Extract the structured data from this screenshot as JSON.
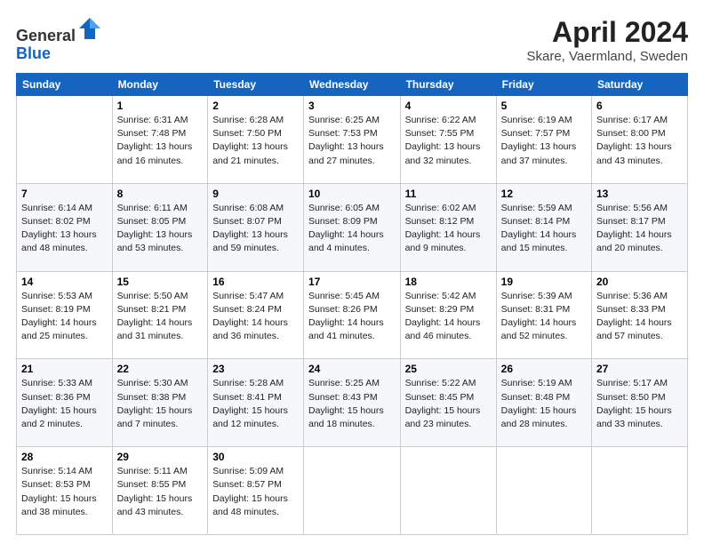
{
  "header": {
    "logo_line1": "General",
    "logo_line2": "Blue",
    "title": "April 2024",
    "subtitle": "Skare, Vaermland, Sweden"
  },
  "days_of_week": [
    "Sunday",
    "Monday",
    "Tuesday",
    "Wednesday",
    "Thursday",
    "Friday",
    "Saturday"
  ],
  "weeks": [
    [
      {
        "day": "",
        "info": ""
      },
      {
        "day": "1",
        "info": "Sunrise: 6:31 AM\nSunset: 7:48 PM\nDaylight: 13 hours\nand 16 minutes."
      },
      {
        "day": "2",
        "info": "Sunrise: 6:28 AM\nSunset: 7:50 PM\nDaylight: 13 hours\nand 21 minutes."
      },
      {
        "day": "3",
        "info": "Sunrise: 6:25 AM\nSunset: 7:53 PM\nDaylight: 13 hours\nand 27 minutes."
      },
      {
        "day": "4",
        "info": "Sunrise: 6:22 AM\nSunset: 7:55 PM\nDaylight: 13 hours\nand 32 minutes."
      },
      {
        "day": "5",
        "info": "Sunrise: 6:19 AM\nSunset: 7:57 PM\nDaylight: 13 hours\nand 37 minutes."
      },
      {
        "day": "6",
        "info": "Sunrise: 6:17 AM\nSunset: 8:00 PM\nDaylight: 13 hours\nand 43 minutes."
      }
    ],
    [
      {
        "day": "7",
        "info": "Sunrise: 6:14 AM\nSunset: 8:02 PM\nDaylight: 13 hours\nand 48 minutes."
      },
      {
        "day": "8",
        "info": "Sunrise: 6:11 AM\nSunset: 8:05 PM\nDaylight: 13 hours\nand 53 minutes."
      },
      {
        "day": "9",
        "info": "Sunrise: 6:08 AM\nSunset: 8:07 PM\nDaylight: 13 hours\nand 59 minutes."
      },
      {
        "day": "10",
        "info": "Sunrise: 6:05 AM\nSunset: 8:09 PM\nDaylight: 14 hours\nand 4 minutes."
      },
      {
        "day": "11",
        "info": "Sunrise: 6:02 AM\nSunset: 8:12 PM\nDaylight: 14 hours\nand 9 minutes."
      },
      {
        "day": "12",
        "info": "Sunrise: 5:59 AM\nSunset: 8:14 PM\nDaylight: 14 hours\nand 15 minutes."
      },
      {
        "day": "13",
        "info": "Sunrise: 5:56 AM\nSunset: 8:17 PM\nDaylight: 14 hours\nand 20 minutes."
      }
    ],
    [
      {
        "day": "14",
        "info": "Sunrise: 5:53 AM\nSunset: 8:19 PM\nDaylight: 14 hours\nand 25 minutes."
      },
      {
        "day": "15",
        "info": "Sunrise: 5:50 AM\nSunset: 8:21 PM\nDaylight: 14 hours\nand 31 minutes."
      },
      {
        "day": "16",
        "info": "Sunrise: 5:47 AM\nSunset: 8:24 PM\nDaylight: 14 hours\nand 36 minutes."
      },
      {
        "day": "17",
        "info": "Sunrise: 5:45 AM\nSunset: 8:26 PM\nDaylight: 14 hours\nand 41 minutes."
      },
      {
        "day": "18",
        "info": "Sunrise: 5:42 AM\nSunset: 8:29 PM\nDaylight: 14 hours\nand 46 minutes."
      },
      {
        "day": "19",
        "info": "Sunrise: 5:39 AM\nSunset: 8:31 PM\nDaylight: 14 hours\nand 52 minutes."
      },
      {
        "day": "20",
        "info": "Sunrise: 5:36 AM\nSunset: 8:33 PM\nDaylight: 14 hours\nand 57 minutes."
      }
    ],
    [
      {
        "day": "21",
        "info": "Sunrise: 5:33 AM\nSunset: 8:36 PM\nDaylight: 15 hours\nand 2 minutes."
      },
      {
        "day": "22",
        "info": "Sunrise: 5:30 AM\nSunset: 8:38 PM\nDaylight: 15 hours\nand 7 minutes."
      },
      {
        "day": "23",
        "info": "Sunrise: 5:28 AM\nSunset: 8:41 PM\nDaylight: 15 hours\nand 12 minutes."
      },
      {
        "day": "24",
        "info": "Sunrise: 5:25 AM\nSunset: 8:43 PM\nDaylight: 15 hours\nand 18 minutes."
      },
      {
        "day": "25",
        "info": "Sunrise: 5:22 AM\nSunset: 8:45 PM\nDaylight: 15 hours\nand 23 minutes."
      },
      {
        "day": "26",
        "info": "Sunrise: 5:19 AM\nSunset: 8:48 PM\nDaylight: 15 hours\nand 28 minutes."
      },
      {
        "day": "27",
        "info": "Sunrise: 5:17 AM\nSunset: 8:50 PM\nDaylight: 15 hours\nand 33 minutes."
      }
    ],
    [
      {
        "day": "28",
        "info": "Sunrise: 5:14 AM\nSunset: 8:53 PM\nDaylight: 15 hours\nand 38 minutes."
      },
      {
        "day": "29",
        "info": "Sunrise: 5:11 AM\nSunset: 8:55 PM\nDaylight: 15 hours\nand 43 minutes."
      },
      {
        "day": "30",
        "info": "Sunrise: 5:09 AM\nSunset: 8:57 PM\nDaylight: 15 hours\nand 48 minutes."
      },
      {
        "day": "",
        "info": ""
      },
      {
        "day": "",
        "info": ""
      },
      {
        "day": "",
        "info": ""
      },
      {
        "day": "",
        "info": ""
      }
    ]
  ]
}
